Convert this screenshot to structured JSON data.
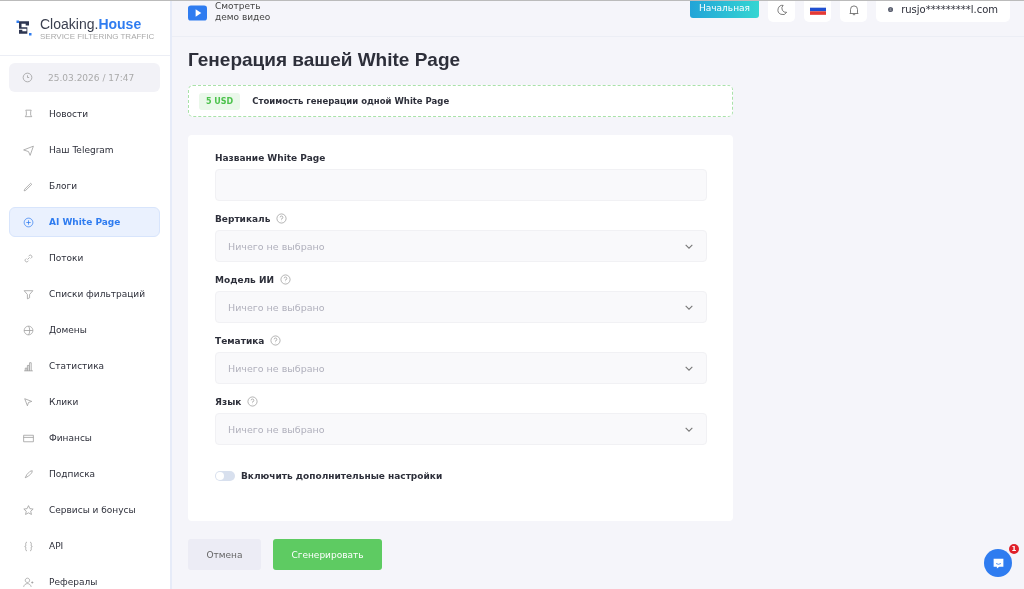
{
  "logo": {
    "name": "Cloaking.",
    "accent": "House",
    "tagline": "SERVICE FILTERING TRAFFIC"
  },
  "datetime": "25.03.2026 / 17:47",
  "sidebar": {
    "items": [
      {
        "label": "Новости",
        "selected": false
      },
      {
        "label": "Наш Telegram",
        "selected": false
      },
      {
        "label": "Блоги",
        "selected": false
      },
      {
        "label": "AI White Page",
        "selected": true
      },
      {
        "label": "Потоки",
        "selected": false
      },
      {
        "label": "Списки фильтраций",
        "selected": false
      },
      {
        "label": "Домены",
        "selected": false
      },
      {
        "label": "Статистика",
        "selected": false
      },
      {
        "label": "Клики",
        "selected": false
      },
      {
        "label": "Финансы",
        "selected": false
      },
      {
        "label": "Подписка",
        "selected": false
      },
      {
        "label": "Сервисы и бонусы",
        "selected": false
      },
      {
        "label": "API",
        "selected": false
      },
      {
        "label": "Рефералы",
        "selected": false
      }
    ]
  },
  "header": {
    "demo_line1": "Смотреть",
    "demo_line2": "демо видео",
    "home_button": "Начальная",
    "user": "rusjo*********l.com"
  },
  "title": "Генерация вашей White Page",
  "cost": {
    "badge": "5 USD",
    "text": "Стоимость генерации одной White Page"
  },
  "form": {
    "fields": [
      {
        "kind": "text",
        "label": "Название White Page"
      },
      {
        "kind": "select",
        "label": "Вертикаль",
        "placeholder": "Ничего не выбрано"
      },
      {
        "kind": "select",
        "label": "Модель ИИ",
        "placeholder": "Ничего не выбрано"
      },
      {
        "kind": "select",
        "label": "Тематика",
        "placeholder": "Ничего не выбрано"
      },
      {
        "kind": "select",
        "label": "Язык",
        "placeholder": "Ничего не выбрано"
      }
    ],
    "toggle": {
      "label": "Включить дополнительные настройки",
      "on": false
    }
  },
  "buttons": {
    "cancel": "Отмена",
    "submit": "Сгенерировать"
  },
  "chat": {
    "badge": "1"
  }
}
